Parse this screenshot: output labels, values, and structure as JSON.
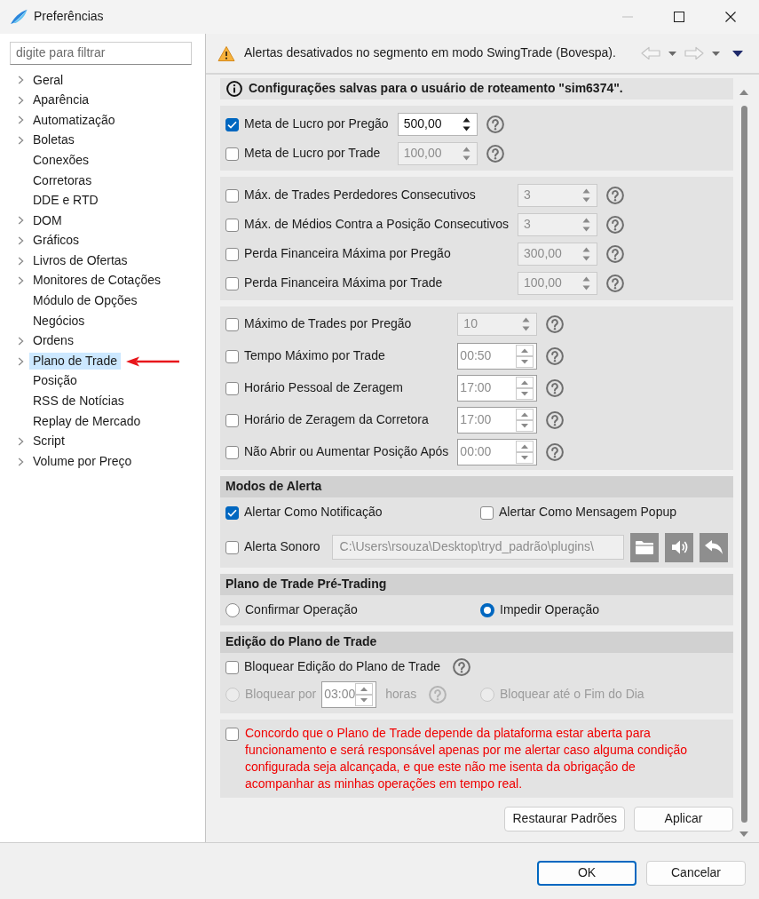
{
  "window": {
    "title": "Preferências",
    "minimize_disabled": true
  },
  "sidebar": {
    "filter": {
      "placeholder": "digite para filtrar"
    },
    "items": [
      {
        "label": "Geral",
        "expandable": true,
        "selected": false
      },
      {
        "label": "Aparência",
        "expandable": true,
        "selected": false
      },
      {
        "label": "Automatização",
        "expandable": true,
        "selected": false
      },
      {
        "label": "Boletas",
        "expandable": true,
        "selected": false
      },
      {
        "label": "Conexões",
        "expandable": false,
        "selected": false
      },
      {
        "label": "Corretoras",
        "expandable": false,
        "selected": false
      },
      {
        "label": "DDE e RTD",
        "expandable": false,
        "selected": false
      },
      {
        "label": "DOM",
        "expandable": true,
        "selected": false
      },
      {
        "label": "Gráficos",
        "expandable": true,
        "selected": false
      },
      {
        "label": "Livros de Ofertas",
        "expandable": true,
        "selected": false
      },
      {
        "label": "Monitores de Cotações",
        "expandable": true,
        "selected": false
      },
      {
        "label": "Módulo de Opções",
        "expandable": false,
        "selected": false
      },
      {
        "label": "Negócios",
        "expandable": false,
        "selected": false
      },
      {
        "label": "Ordens",
        "expandable": true,
        "selected": false
      },
      {
        "label": "Plano de Trade",
        "expandable": true,
        "selected": true
      },
      {
        "label": "Posição",
        "expandable": false,
        "selected": false
      },
      {
        "label": "RSS de Notícias",
        "expandable": false,
        "selected": false
      },
      {
        "label": "Replay de Mercado",
        "expandable": false,
        "selected": false
      },
      {
        "label": "Script",
        "expandable": true,
        "selected": false
      },
      {
        "label": "Volume por Preço",
        "expandable": true,
        "selected": false
      }
    ]
  },
  "alert_bar": {
    "message": "Alertas desativados no segmento em modo SwingTrade (Bovespa).",
    "back_disabled": true,
    "forward_disabled": true
  },
  "info_banner": {
    "text": "Configurações salvas para o usuário de roteamento \"sim6374\"."
  },
  "limit_groups": [
    {
      "rows": [
        {
          "label": "Meta de Lucro por Pregão",
          "checked": true,
          "field": {
            "kind": "number",
            "value": "500,00",
            "disabled": false
          }
        },
        {
          "label": "Meta de Lucro por Trade",
          "checked": false,
          "field": {
            "kind": "number",
            "value": "100,00",
            "disabled": true
          }
        }
      ]
    },
    {
      "rows": [
        {
          "label": "Máx. de Trades Perdedores Consecutivos",
          "checked": false,
          "field": {
            "kind": "number",
            "value": "3",
            "disabled": true
          }
        },
        {
          "label": "Máx. de Médios Contra a Posição Consecutivos",
          "checked": false,
          "field": {
            "kind": "number",
            "value": "3",
            "disabled": true
          }
        },
        {
          "label": "Perda Financeira Máxima por Pregão",
          "checked": false,
          "field": {
            "kind": "number",
            "value": "300,00",
            "disabled": true
          }
        },
        {
          "label": "Perda Financeira Máxima por Trade",
          "checked": false,
          "field": {
            "kind": "number",
            "value": "100,00",
            "disabled": true
          }
        }
      ]
    },
    {
      "rows": [
        {
          "label": "Máximo de Trades por Pregão",
          "checked": false,
          "field": {
            "kind": "number",
            "value": "10",
            "disabled": true
          }
        },
        {
          "label": "Tempo Máximo por Trade",
          "checked": false,
          "field": {
            "kind": "time",
            "value": "00:50",
            "disabled": true
          }
        },
        {
          "label": "Horário Pessoal de Zeragem",
          "checked": false,
          "field": {
            "kind": "time",
            "value": "17:00",
            "disabled": true
          }
        },
        {
          "label": "Horário de Zeragem da Corretora",
          "checked": false,
          "field": {
            "kind": "time",
            "value": "17:00",
            "disabled": true
          }
        },
        {
          "label": "Não Abrir ou Aumentar Posição Após",
          "checked": false,
          "field": {
            "kind": "time",
            "value": "00:00",
            "disabled": true
          }
        }
      ]
    }
  ],
  "alert_modes": {
    "title": "Modos de Alerta",
    "options": [
      {
        "label": "Alertar Como Notificação",
        "checked": true
      },
      {
        "label": "Alertar Como Mensagem Popup",
        "checked": false
      }
    ],
    "sound": {
      "label": "Alerta Sonoro",
      "checked": false,
      "path": "C:\\Users\\rsouza\\Desktop\\tryd_padrão\\plugins\\"
    }
  },
  "pre_trading": {
    "title": "Plano de Trade Pré-Trading",
    "options": [
      {
        "label": "Confirmar Operação",
        "selected": false
      },
      {
        "label": "Impedir Operação",
        "selected": true
      }
    ]
  },
  "edit_lock": {
    "title": "Edição do Plano de Trade",
    "lock": {
      "label": "Bloquear Edição do Plano de Trade",
      "checked": false
    },
    "options": [
      {
        "kind": "duration",
        "label": "Bloquear por",
        "selected": false,
        "disabled": true,
        "value": "03:00",
        "unit": "horas"
      },
      {
        "kind": "plain",
        "label": "Bloquear até o Fim do Dia",
        "selected": false,
        "disabled": true
      }
    ]
  },
  "disclaimer": {
    "checked": false,
    "text": "Concordo que o Plano de Trade depende da plataforma estar aberta para funcionamento e será responsável apenas por me alertar caso alguma condição configurada seja alcançada, e que este não me isenta da obrigação de acompanhar as minhas operações em tempo real."
  },
  "panel_buttons": [
    "Restaurar Padrões",
    "Aplicar"
  ],
  "dialog_buttons": [
    {
      "label": "OK",
      "focused": true
    },
    {
      "label": "Cancelar",
      "focused": false
    }
  ]
}
